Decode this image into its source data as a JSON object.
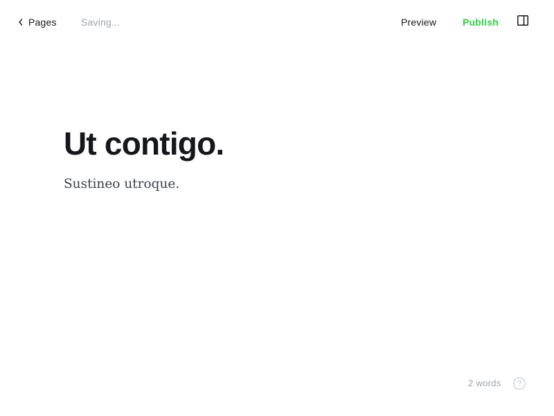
{
  "header": {
    "back_label": "Pages",
    "status_text": "Saving...",
    "preview_label": "Preview",
    "publish_label": "Publish",
    "icons": {
      "back": "chevron-left-icon",
      "sidebar_toggle": "sidebar-panel-icon"
    }
  },
  "editor": {
    "title": "Ut contigo.",
    "body": "Sustineo utroque."
  },
  "footer": {
    "word_count": "2 words",
    "help_icon": "question-mark-icon"
  },
  "colors": {
    "publish_accent": "#30cf43",
    "text_primary": "#15171a",
    "text_muted": "#9aa3ad",
    "background": "#ffffff"
  }
}
